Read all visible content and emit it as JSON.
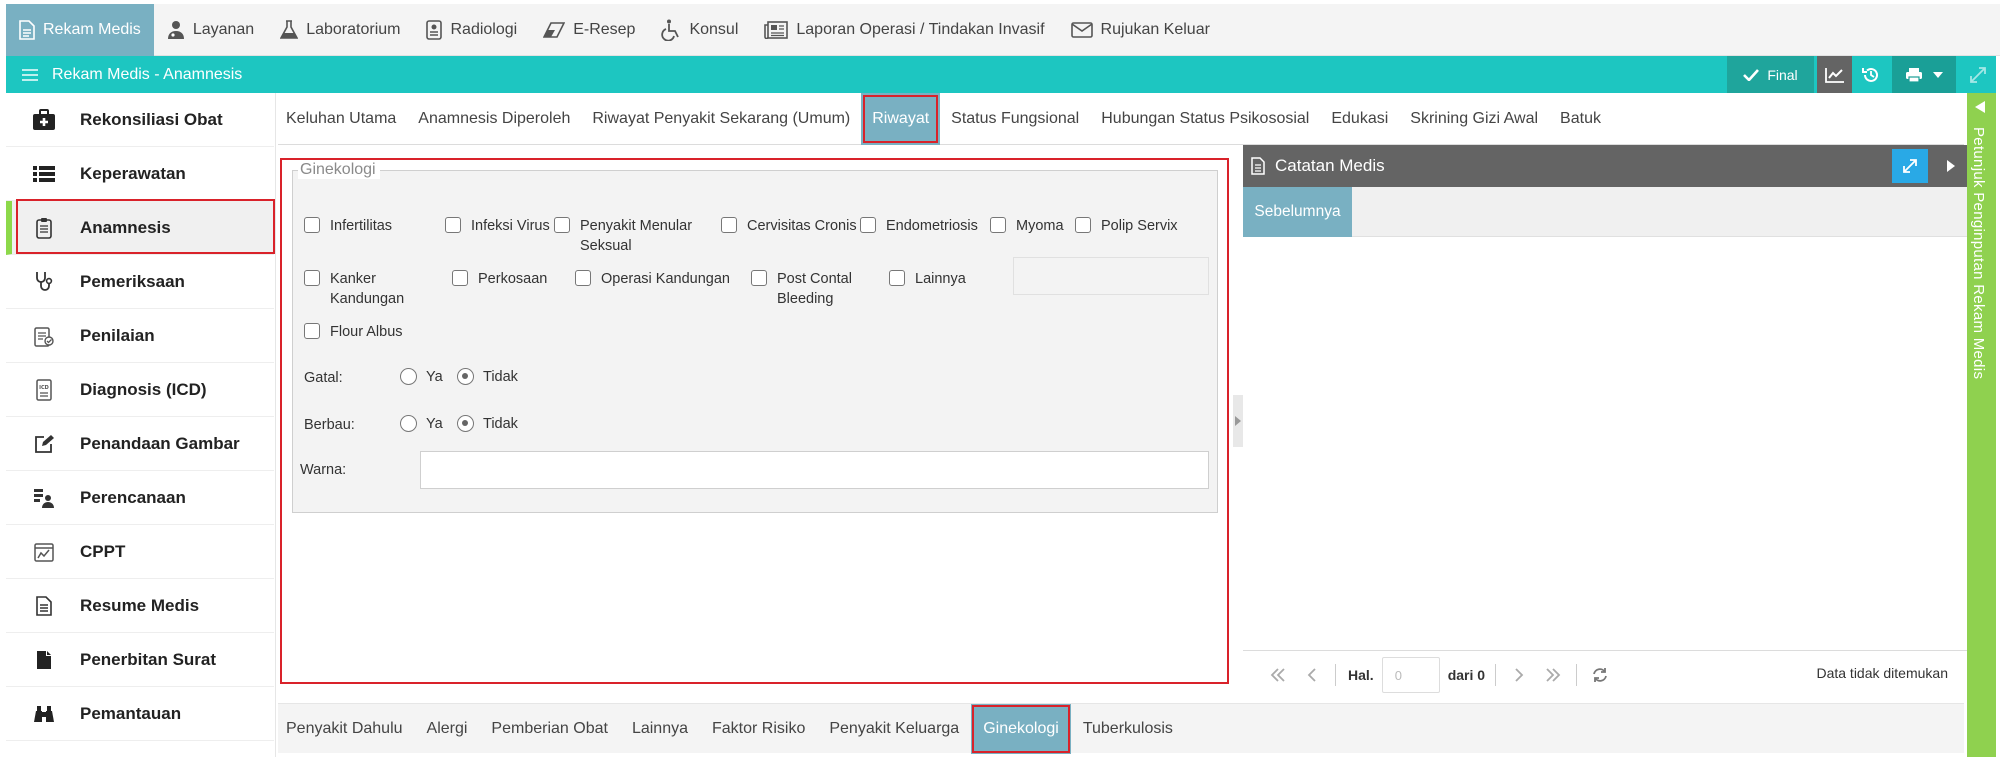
{
  "topnav": {
    "items": [
      {
        "label": "Rekam Medis",
        "icon": "document-icon",
        "active": true
      },
      {
        "label": "Layanan",
        "icon": "doctor-icon",
        "active": false
      },
      {
        "label": "Laboratorium",
        "icon": "flask-icon",
        "active": false
      },
      {
        "label": "Radiologi",
        "icon": "xray-icon",
        "active": false
      },
      {
        "label": "E-Resep",
        "icon": "eraser-icon",
        "active": false
      },
      {
        "label": "Konsul",
        "icon": "wheelchair-icon",
        "active": false
      },
      {
        "label": "Laporan Operasi / Tindakan Invasif",
        "icon": "newspaper-icon",
        "active": false
      },
      {
        "label": "Rujukan Keluar",
        "icon": "envelope-icon",
        "active": false
      }
    ]
  },
  "header": {
    "title": "Rekam Medis - Anamnesis",
    "final_label": "Final",
    "accent": "#1dc6c1"
  },
  "sidebar": {
    "items": [
      {
        "label": "Rekonsiliasi Obat",
        "icon": "medkit-icon"
      },
      {
        "label": "Keperawatan",
        "icon": "list-icon"
      },
      {
        "label": "Anamnesis",
        "icon": "clipboard-icon",
        "active": true
      },
      {
        "label": "Pemeriksaan",
        "icon": "stethoscope-icon"
      },
      {
        "label": "Penilaian",
        "icon": "assessment-icon"
      },
      {
        "label": "Diagnosis (ICD)",
        "icon": "icd-icon"
      },
      {
        "label": "Penandaan Gambar",
        "icon": "edit-icon"
      },
      {
        "label": "Perencanaan",
        "icon": "planning-icon"
      },
      {
        "label": "CPPT",
        "icon": "cppt-icon"
      },
      {
        "label": "Resume Medis",
        "icon": "file-text-icon"
      },
      {
        "label": "Penerbitan Surat",
        "icon": "file-icon"
      },
      {
        "label": "Pemantauan",
        "icon": "binoculars-icon"
      }
    ]
  },
  "tabs": [
    {
      "label": "Keluhan Utama"
    },
    {
      "label": "Anamnesis Diperoleh"
    },
    {
      "label": "Riwayat Penyakit Sekarang (Umum)"
    },
    {
      "label": "Riwayat",
      "active": true
    },
    {
      "label": "Status Fungsional"
    },
    {
      "label": "Hubungan Status Psikososial"
    },
    {
      "label": "Edukasi"
    },
    {
      "label": "Skrining Gizi Awal"
    },
    {
      "label": "Batuk"
    }
  ],
  "ginekologi": {
    "legend": "Ginekologi",
    "checkboxes": {
      "infertilitas": "Infertilitas",
      "infeksi_virus": "Infeksi Virus",
      "penyakit_menular_1": "Penyakit Menular",
      "penyakit_menular_2": "Seksual",
      "cervisitas": "Cervisitas Cronis",
      "endometriosis": "Endometriosis",
      "myoma": "Myoma",
      "polip": "Polip Servix",
      "kanker_1": "Kanker",
      "kanker_2": "Kandungan",
      "perkosaan": "Perkosaan",
      "operasi": "Operasi Kandungan",
      "post_contal_1": "Post Contal",
      "post_contal_2": "Bleeding",
      "lainnya": "Lainnya",
      "flour": "Flour Albus"
    },
    "gatal": {
      "label": "Gatal:",
      "ya": "Ya",
      "tidak": "Tidak",
      "selected": "Tidak"
    },
    "berbau": {
      "label": "Berbau:",
      "ya": "Ya",
      "tidak": "Tidak",
      "selected": "Tidak"
    },
    "warna": {
      "label": "Warna:",
      "value": ""
    }
  },
  "catatan": {
    "title": "Catatan Medis",
    "tab": "Sebelumnya",
    "pager": {
      "hal_label": "Hal.",
      "page_value": "0",
      "dari_label": "dari 0",
      "status": "Data tidak ditemukan"
    }
  },
  "petunjuk": {
    "label": "Petunjuk Penginputan Rekam Medis"
  },
  "bottom_tabs": [
    {
      "label": "Penyakit Dahulu"
    },
    {
      "label": "Alergi"
    },
    {
      "label": "Pemberian Obat"
    },
    {
      "label": "Lainnya"
    },
    {
      "label": "Faktor Risiko"
    },
    {
      "label": "Penyakit Keluarga"
    },
    {
      "label": "Ginekologi",
      "active": true
    },
    {
      "label": "Tuberkulosis"
    }
  ]
}
